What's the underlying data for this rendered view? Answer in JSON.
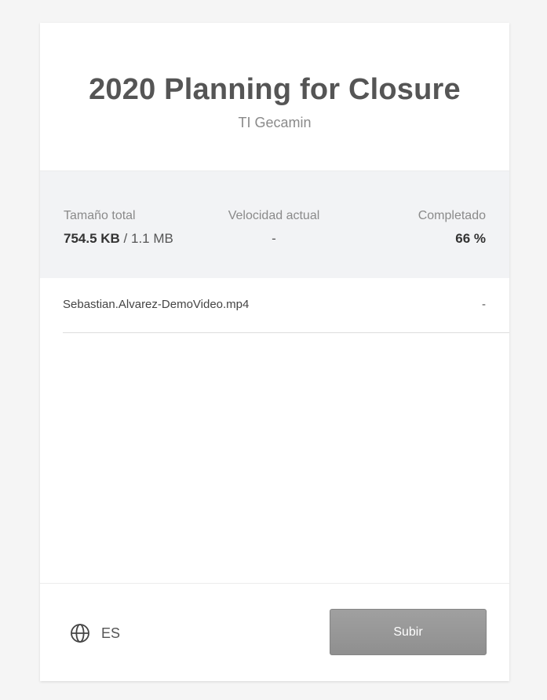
{
  "header": {
    "title": "2020 Planning for Closure",
    "subtitle": "TI Gecamin"
  },
  "stats": {
    "total_label": "Tamaño total",
    "total_uploaded": "754.5 KB",
    "total_separator": " / ",
    "total_size": "1.1 MB",
    "speed_label": "Velocidad actual",
    "speed_value": "-",
    "completed_label": "Completado",
    "completed_value": "66 %",
    "completed_fraction": 0.66
  },
  "files": [
    {
      "name": "Sebastian.Alvarez-DemoVideo.mp4",
      "status": "-"
    }
  ],
  "footer": {
    "language_icon": "globe-icon",
    "language_code": "ES",
    "upload_label": "Subir"
  },
  "colors": {
    "background": "#f5f5f5",
    "card": "#ffffff",
    "stats_band": "#f2f3f5",
    "button": "#999999"
  }
}
